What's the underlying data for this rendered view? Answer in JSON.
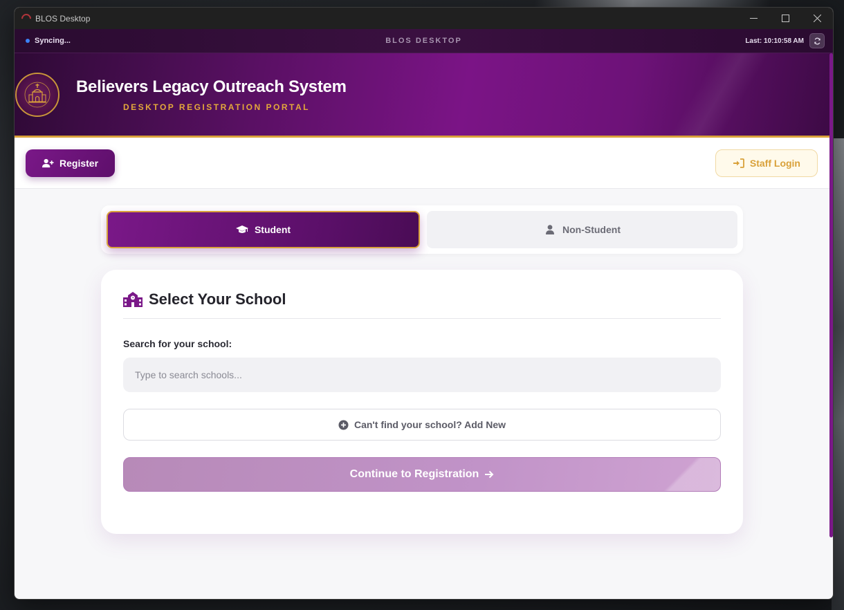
{
  "window": {
    "title": "BLOS Desktop"
  },
  "sync_bar": {
    "status": "Syncing...",
    "center_title": "BLOS DESKTOP",
    "last_sync": "Last: 10:10:58 AM"
  },
  "header": {
    "title": "Believers Legacy Outreach System",
    "subtitle": "DESKTOP REGISTRATION PORTAL"
  },
  "nav": {
    "register_label": "Register",
    "staff_login_label": "Staff Login"
  },
  "tabs": [
    {
      "label": "Student",
      "active": true,
      "icon": "graduation-cap-icon"
    },
    {
      "label": "Non-Student",
      "active": false,
      "icon": "user-icon"
    }
  ],
  "school_card": {
    "title": "Select Your School",
    "search_label": "Search for your school:",
    "search_placeholder": "Type to search schools...",
    "search_value": "",
    "add_new_label": "Can't find your school? Add New",
    "continue_label": "Continue to Registration"
  },
  "colors": {
    "brand_purple": "#7a1888",
    "accent_gold": "#d9a13a",
    "sync_dot": "#3b82f6"
  }
}
